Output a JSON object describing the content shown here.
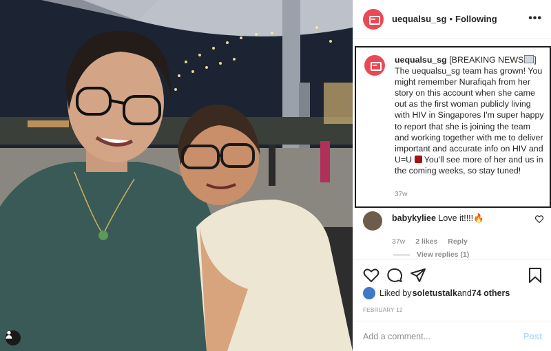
{
  "post": {
    "username": "uequalsu_sg",
    "separator": "•",
    "follow_state": "Following",
    "more_icon": "more-options-icon",
    "caption": {
      "username": "uequalsu_sg",
      "text_before_emoji": " [BREAKING NEWS",
      "text_after_emoji": "] The uequalsu_sg team has grown! You might remember Nurafiqah from her story on this account when she came out as the first woman publicly living with HIV in Singapore⁠s I'm super happy to report that she is joining the team and working together with me to deliver important and accurate info on HIV and U=U ",
      "text_tail": " You'll see more of her and us in the coming weeks, so stay tuned!",
      "time": "37w"
    },
    "comment": {
      "username": "babykyliee",
      "text": " Love it!!!!🔥",
      "time": "37w",
      "likes": "2 likes",
      "reply": "Reply",
      "view_replies": "View replies (1)"
    },
    "likes_line": {
      "prefix": "Liked by ",
      "user": "soletustalk",
      "middle": " and ",
      "others": "74 others"
    },
    "date": "FEBRUARY 12",
    "add_comment": {
      "placeholder": "Add a comment...",
      "post_label": "Post"
    },
    "icons": [
      "heart-icon",
      "comment-icon",
      "share-icon",
      "bookmark-icon"
    ],
    "colors": {
      "avatar": "#e84a55",
      "post_button": "#b3dbff",
      "meta_text": "#8e8e8e"
    }
  }
}
